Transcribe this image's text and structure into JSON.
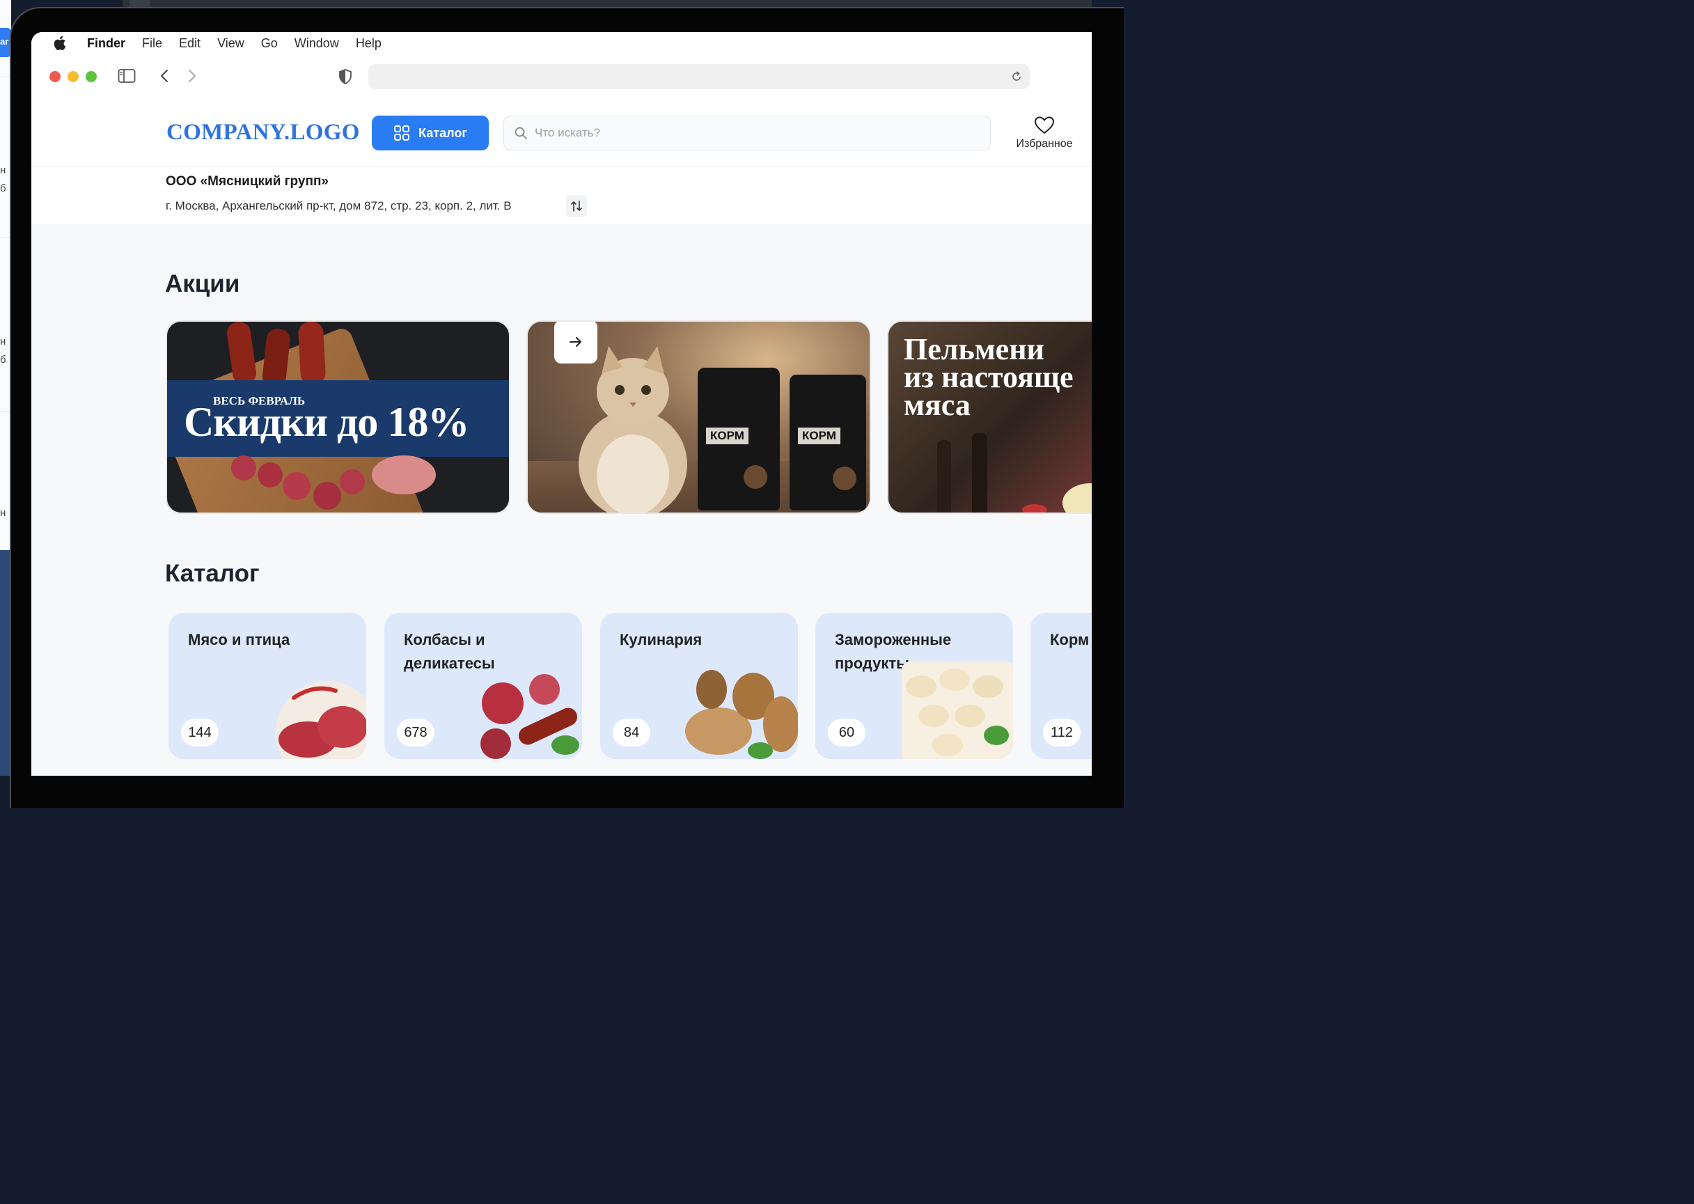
{
  "menubar": {
    "apple_icon": "apple-logo-icon",
    "items": [
      "Finder",
      "File",
      "Edit",
      "View",
      "Go",
      "Window",
      "Help"
    ]
  },
  "browser": {
    "icons": [
      "sidebar-icon",
      "back-chevron-icon",
      "forward-chevron-icon",
      "shield-icon",
      "reload-icon"
    ],
    "url": ""
  },
  "header": {
    "logo": "COMPANY.LOGO",
    "catalog_button": "Каталог",
    "search_placeholder": "Что искать?",
    "favorites_label": "Избранное"
  },
  "company": {
    "name": "ООО «Мясницкий групп»",
    "address": "г. Москва, Архангельский пр-кт, дом 872, стр. 23, корп. 2, лит. В"
  },
  "promos": {
    "title": "Акции",
    "banner1": {
      "small": "ВЕСЬ ФЕВРАЛЬ",
      "big": "Скидки до 18%"
    },
    "banner2": {
      "bag_label_1": "КОРМ",
      "bag_label_2": "КОРМ"
    },
    "banner3": {
      "line1": "Пельмени",
      "line2": "из настояще",
      "line3": "мяса"
    }
  },
  "catalog": {
    "title": "Каталог",
    "categories": [
      {
        "name": "Мясо и птица",
        "count": "144"
      },
      {
        "name": "Колбасы и деликатесы",
        "count": "678"
      },
      {
        "name": "Кулинария",
        "count": "84"
      },
      {
        "name": "Замороженные продукты",
        "count": "60"
      },
      {
        "name": "Корм для ж",
        "count": "112"
      }
    ]
  },
  "colors": {
    "accent": "#2a7cf2",
    "logo": "#2f72e0",
    "card_bg": "#dde9fb",
    "promo_band": "#1a3a6c"
  }
}
